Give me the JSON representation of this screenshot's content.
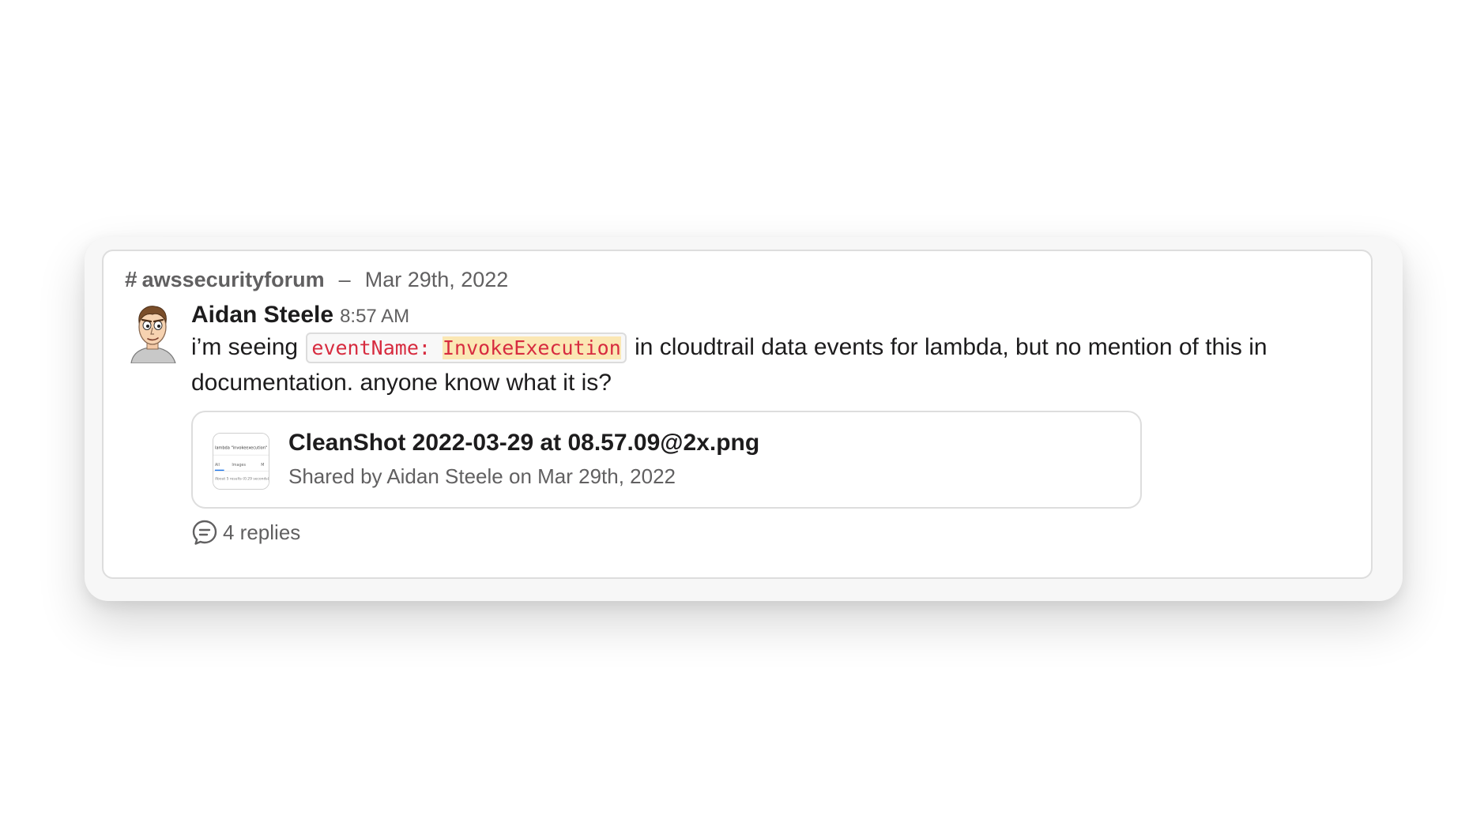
{
  "channel": {
    "hash": "#",
    "name": "awssecurityforum",
    "separator": "–",
    "date": "Mar 29th, 2022"
  },
  "message": {
    "avatar_icon": "cartoon-avatar-icon",
    "author": "Aidan Steele",
    "time": "8:57 AM",
    "text_before": "i’m seeing",
    "code_key": "eventName: ",
    "code_value": "InvokeExecution",
    "text_after": "in cloudtrail data events for lambda, but no mention of this in documentation. anyone know what it is?"
  },
  "attachment": {
    "thumb_icon": "screenshot-thumbnail-icon",
    "thumb_caption": "lambda \"invokeexecution\"",
    "thumb_tabs": [
      "All",
      "Images",
      "M"
    ],
    "thumb_results": "About 5 results (0.29 seconds)",
    "title": "CleanShot 2022-03-29 at 08.57.09@2x.png",
    "subtitle": "Shared by Aidan Steele on Mar 29th, 2022"
  },
  "thread": {
    "icon": "speech-bubble-icon",
    "label": "4 replies"
  },
  "colors": {
    "code_text": "#d72b3f",
    "code_highlight": "#fbe7b4",
    "secondary_text": "#616061",
    "primary_text": "#1d1c1d"
  }
}
